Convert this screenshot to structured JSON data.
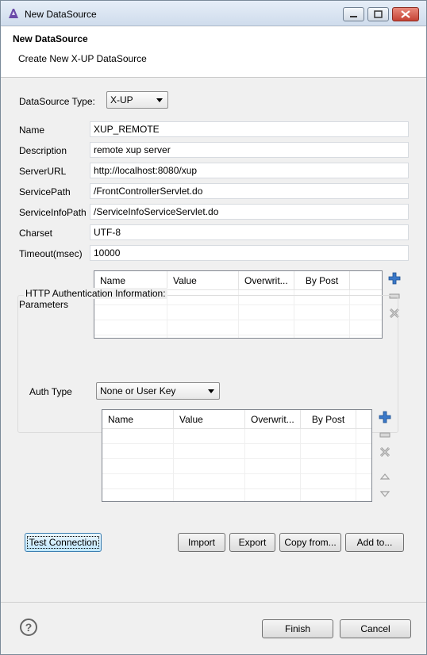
{
  "window": {
    "title": "New DataSource"
  },
  "header": {
    "title": "New DataSource",
    "subtitle": "Create New X-UP DataSource"
  },
  "form": {
    "datasource_type_label": "DataSource Type:",
    "datasource_type_value": "X-UP",
    "fields": [
      {
        "label": "Name",
        "value": "XUP_REMOTE"
      },
      {
        "label": "Description",
        "value": "remote xup server"
      },
      {
        "label": "ServerURL",
        "value": "http://localhost:8080/xup"
      },
      {
        "label": "ServicePath",
        "value": "/FrontControllerServlet.do"
      },
      {
        "label": "ServiceInfoPath",
        "value": "/ServiceInfoServiceServlet.do"
      },
      {
        "label": "Charset",
        "value": "UTF-8"
      },
      {
        "label": "Timeout(msec)",
        "value": "10000"
      }
    ],
    "parameters_label": "Parameters",
    "parameters_columns": [
      "Name",
      "Value",
      "Overwrit...",
      "By Post"
    ]
  },
  "auth": {
    "group_title": "HTTP Authentication Information:",
    "auth_type_label": "Auth Type",
    "auth_type_value": "None or User Key",
    "columns": [
      "Name",
      "Value",
      "Overwrit...",
      "By Post"
    ]
  },
  "buttons": {
    "test_connection": "Test Connection",
    "import": "Import",
    "export": "Export",
    "copy_from": "Copy from...",
    "add_to": "Add to...",
    "finish": "Finish",
    "cancel": "Cancel"
  },
  "icons": {
    "add": "plus-icon",
    "edit": "edit-icon",
    "delete": "delete-icon",
    "up": "move-up-icon",
    "down": "move-down-icon",
    "help": "help-icon"
  },
  "colors": {
    "accent_blue": "#3a78c8",
    "focus_border": "#3c7fb1"
  }
}
